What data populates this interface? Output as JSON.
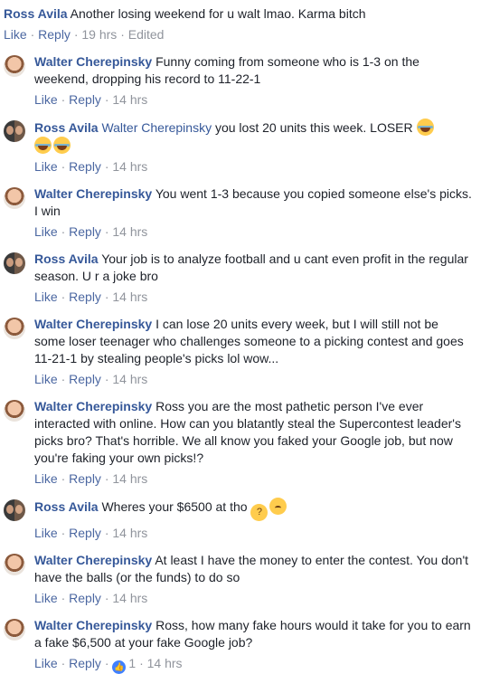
{
  "top_comment": {
    "author": "Ross Avila",
    "text": "Another losing weekend for u walt lmao. Karma bitch",
    "like": "Like",
    "reply": "Reply",
    "time": "19 hrs",
    "edited": "Edited"
  },
  "replies": [
    {
      "author": "Walter Cherepinsky",
      "text": "Funny coming from someone who is 1-3 on the weekend, dropping his record to 11-22-1",
      "like": "Like",
      "reply": "Reply",
      "time": "14 hrs"
    },
    {
      "author": "Ross Avila",
      "mention": "Walter Cherepinsky",
      "text": "you lost 20 units this week. LOSER",
      "like": "Like",
      "reply": "Reply",
      "time": "14 hrs"
    },
    {
      "author": "Walter Cherepinsky",
      "text": "You went 1-3 because you copied someone else's picks. I win",
      "like": "Like",
      "reply": "Reply",
      "time": "14 hrs"
    },
    {
      "author": "Ross Avila",
      "text": "Your job is to analyze football and u cant even profit in the regular season. U r a joke bro",
      "like": "Like",
      "reply": "Reply",
      "time": "14 hrs"
    },
    {
      "author": "Walter Cherepinsky",
      "text": "I can lose 20 units every week, but I will still not be some loser teenager who challenges someone to a picking contest and goes 11-21-1 by stealing people's picks lol wow...",
      "like": "Like",
      "reply": "Reply",
      "time": "14 hrs"
    },
    {
      "author": "Walter Cherepinsky",
      "text": "Ross you are the most pathetic person I've ever interacted with online. How can you blatantly steal the Supercontest leader's picks bro? That's horrible. We all know you faked your Google job, but now you're faking your own picks!?",
      "like": "Like",
      "reply": "Reply",
      "time": "14 hrs"
    },
    {
      "author": "Ross Avila",
      "text": "Wheres your $6500 at tho",
      "like": "Like",
      "reply": "Reply",
      "time": "14 hrs"
    },
    {
      "author": "Walter Cherepinsky",
      "text": "At least I have the money to enter the contest. You don't have the balls (or the funds) to do so",
      "like": "Like",
      "reply": "Reply",
      "time": "14 hrs"
    },
    {
      "author": "Walter Cherepinsky",
      "text": "Ross, how many fake hours would it take for you to earn a fake $6,500 at your fake Google job?",
      "like": "Like",
      "reply": "Reply",
      "time": "14 hrs",
      "reactions": "1"
    }
  ],
  "icons": {
    "laugh": "tears-of-joy-emoji",
    "think": "thinking-face-emoji",
    "frown": "slightly-frowning-emoji",
    "like": "like-thumb-icon"
  },
  "colors": {
    "author": "#365899",
    "meta": "#90949c",
    "link": "#4b67a1",
    "like_badge": "#4080ff"
  }
}
